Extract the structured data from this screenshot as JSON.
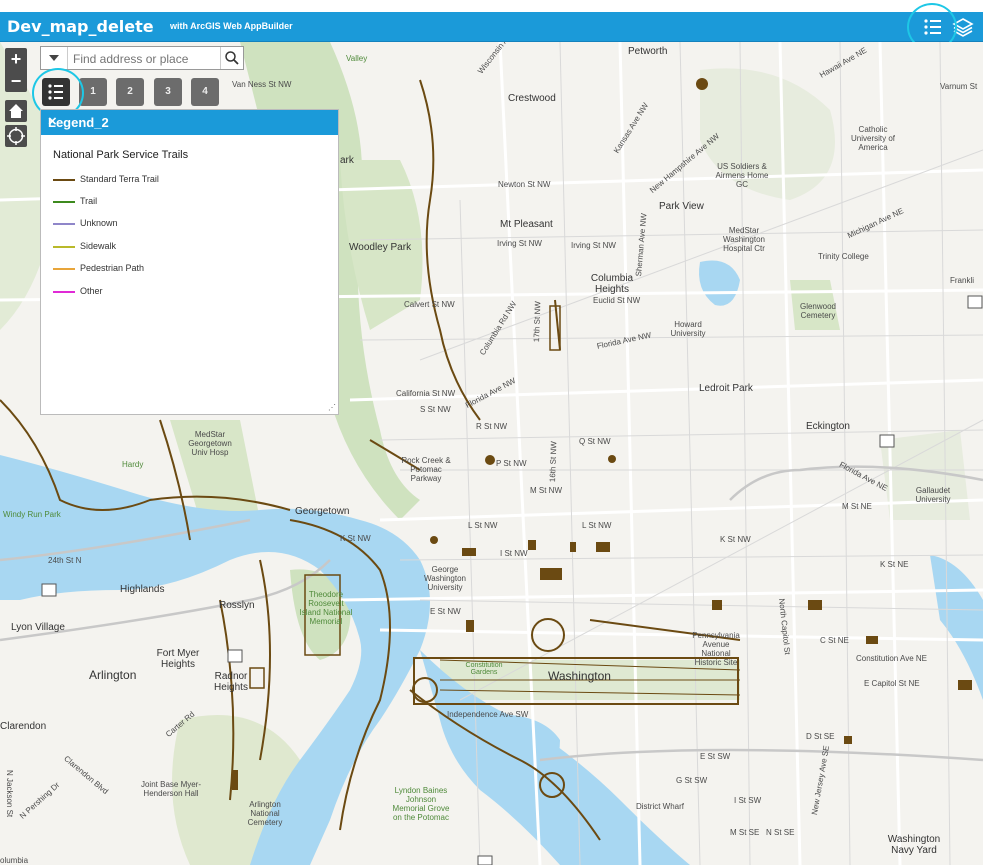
{
  "header": {
    "title": "Dev_map_delete",
    "subtitle": "with ArcGIS Web AppBuilder"
  },
  "search": {
    "placeholder": "Find address or place"
  },
  "controls": {
    "zoom_in": "+",
    "zoom_out": "−",
    "numbers": [
      "1",
      "2",
      "3",
      "4"
    ]
  },
  "legend": {
    "title": "Legend_2",
    "close": "×",
    "layer_title": "National Park Service Trails",
    "items": [
      {
        "label": "Standard Terra Trail",
        "color": "#6b4a12"
      },
      {
        "label": "Trail",
        "color": "#3d8a1e"
      },
      {
        "label": "Unknown",
        "color": "#8f86c9"
      },
      {
        "label": "Sidewalk",
        "color": "#b9b92a"
      },
      {
        "label": "Pedestrian Path",
        "color": "#e8a53a"
      },
      {
        "label": "Other",
        "color": "#e02ad6"
      }
    ]
  },
  "map_labels": {
    "petworth": "Petworth",
    "crestwood": "Crestwood",
    "mt_pleasant": "Mt Pleasant",
    "park_view": "Park View",
    "columbia_heights": "Columbia Heights",
    "woodley_park": "Woodley Park",
    "ledroit_park": "Ledroit Park",
    "eckington": "Eckington",
    "georgetown": "Georgetown",
    "rosslyn": "Rosslyn",
    "highlands": "Highlands",
    "lyon_village": "Lyon Village",
    "arlington": "Arlington",
    "fort_myer_heights": "Fort Myer Heights",
    "radnor_heights": "Radnor Heights",
    "clarendon": "Clarendon",
    "washington": "Washington",
    "washington_navy_yard": "Washington Navy Yard",
    "catholic_university": "Catholic University of America",
    "us_soldiers": "US Soldiers & Airmens Home GC",
    "medstar_washington": "MedStar Washington Hospital Ctr",
    "trinity_college": "Trinity College",
    "glenwood_cemetery": "Glenwood Cemetery",
    "howard_university": "Howard University",
    "gallaudet": "Gallaudet University",
    "medstar_georgetown": "MedStar Georgetown Univ Hosp",
    "hardy": "Hardy",
    "rock_creek": "Rock Creek & Potomac Parkway",
    "george_washington": "George Washington University",
    "theodore_roosevelt": "Theodore Roosevelt Island National Memorial",
    "pennsylvania_avenue": "Pennsylvania Avenue National Historic Site",
    "joint_base": "Joint Base Myer-Henderson Hall",
    "arlington_cemetery": "Arlington National Cemetery",
    "lyndon_johnson": "Lyndon Baines Johnson Memorial Grove on the Potomac",
    "district_wharf": "District Wharf",
    "constitution_gardens": "Constitution Gardens",
    "independence_ave": "Independence Ave SW",
    "constitution_ave_ne": "Constitution Ave NE",
    "e_capitol_st": "E Capitol St NE",
    "newton_st": "Newton St NW",
    "irving_st": "Irving St NW",
    "irving_st2": "Irving St NW",
    "euclid_st": "Euclid St NW",
    "calvert_st": "Calvert St NW",
    "california_st": "California St NW",
    "s_st": "S St NW",
    "r_st": "R St NW",
    "q_st": "Q St NW",
    "p_st": "P St NW",
    "m_st": "M St NW",
    "l_st": "L St NW",
    "l_st2": "L St NW",
    "k_st": "K St NW",
    "k_st2": "K St NW",
    "i_st": "I St NW",
    "e_st": "E St NW",
    "florida_ave": "Florida Ave NW",
    "florida_ave2": "Florida Ave NW",
    "florida_ave_ne": "Florida Ave NE",
    "van_ness": "Van Ness St NW",
    "windy_run": "Windy Run Park",
    "street_24": "24th St N",
    "n_capitol": "North Capitol St",
    "michigan_ave": "Michigan Ave NE",
    "kansas_ave": "Kansas Ave NW",
    "new_hampshire": "New Hampshire Ave NW",
    "sherman_ave": "Sherman Ave NW",
    "columbia_rd": "Columbia Rd NW",
    "street_16": "16th St NW",
    "street_17": "17th St NW",
    "c_st_ne": "C St NE",
    "d_st_se": "D St SE",
    "g_st_sw": "G St SW",
    "m_st_se": "M St SE",
    "i_st_sw": "I St SW",
    "e_st_sw": "E St SW",
    "n_st_se": "N St SE",
    "k_st_ne": "K St NE",
    "m_st_ne": "M St NE",
    "hawaii_ave": "Hawaii Ave NE",
    "varnum_st": "Varnum St",
    "franklin": "Frankli",
    "wisconsin_ave": "Wisconsin Ave NW",
    "pershing": "N Pershing Dr",
    "clarendon_blvd": "Clarendon Blvd",
    "jackson_st": "N Jackson St",
    "carter_rd": "Carter Rd",
    "valley": "Valley",
    "ark": "ark",
    "new_jersey": "New Jersey Ave SE",
    "columbia_label": "olumbia"
  }
}
